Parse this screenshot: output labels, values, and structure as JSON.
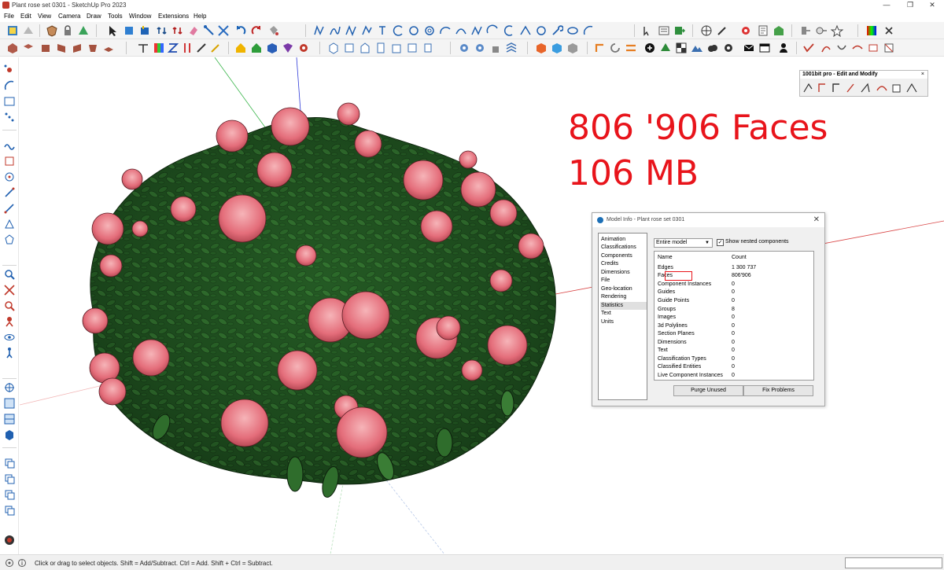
{
  "window": {
    "title": "Plant rose set 0301 - SketchUp Pro 2023",
    "minimize": "—",
    "restore": "❐",
    "close": "✕"
  },
  "menu": [
    "File",
    "Edit",
    "View",
    "Camera",
    "Draw",
    "Tools",
    "Window",
    "Extensions",
    "Help"
  ],
  "viewport": {
    "overlay_line1": "806 '906 Faces",
    "overlay_line2": "106 MB",
    "overlay_color": "#e8141b"
  },
  "floating_toolbar": {
    "title": "1001bit pro - Edit and Modify",
    "close": "×"
  },
  "model_info": {
    "title": "Model Info - Plant rose set 0301",
    "close": "✕",
    "categories": [
      "Animation",
      "Classifications",
      "Components",
      "Credits",
      "Dimensions",
      "File",
      "Geo-location",
      "Rendering",
      "Statistics",
      "Text",
      "Units"
    ],
    "selected_category": "Statistics",
    "scope_value": "Entire model",
    "nested_checked": true,
    "nested_label": "Show nested components",
    "header_name": "Name",
    "header_count": "Count",
    "rows": [
      {
        "name": "Edges",
        "count": "1 300 737"
      },
      {
        "name": "Faces",
        "count": "806'906"
      },
      {
        "name": "Component Instances",
        "count": "0"
      },
      {
        "name": "Guides",
        "count": "0"
      },
      {
        "name": "Guide Points",
        "count": "0"
      },
      {
        "name": "Groups",
        "count": "8"
      },
      {
        "name": "Images",
        "count": "0"
      },
      {
        "name": "3d Polylines",
        "count": "0"
      },
      {
        "name": "Section Planes",
        "count": "0"
      },
      {
        "name": "Dimensions",
        "count": "0"
      },
      {
        "name": "Text",
        "count": "0"
      },
      {
        "name": "Classification Types",
        "count": "0"
      },
      {
        "name": "Classified Entities",
        "count": "0"
      },
      {
        "name": "Live Component Instances",
        "count": "0"
      }
    ],
    "purge_label": "Purge Unused",
    "fix_label": "Fix Problems"
  },
  "status": {
    "message": "Click or drag to select objects. Shift = Add/Subtract. Ctrl = Add. Shift + Ctrl = Subtract."
  }
}
